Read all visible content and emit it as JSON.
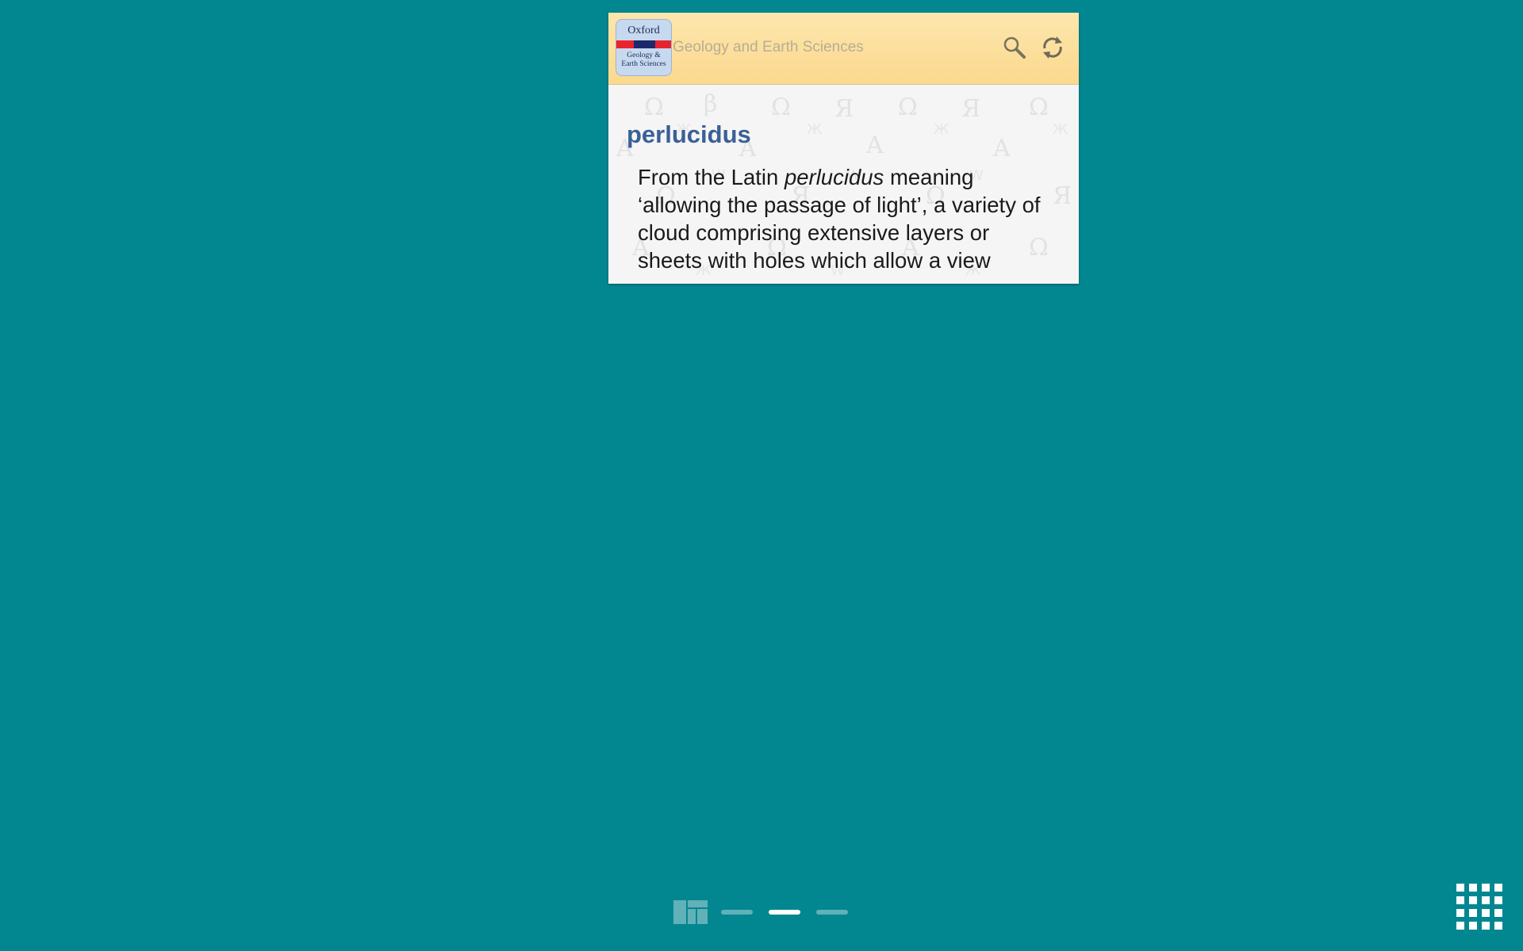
{
  "widget": {
    "logo": {
      "top_text": "Oxford",
      "bottom_line1": "Geology &",
      "bottom_line2": "Earth Sciences"
    },
    "title": "Geology and Earth Sciences",
    "icons": {
      "search": "search-icon",
      "refresh": "refresh-icon"
    },
    "entry": {
      "headword": "perlucidus",
      "text_before": "From the Latin ",
      "text_italic": "perlucidus",
      "text_after": " meaning ‘allowing the passage of light’, a variety of cloud comprising extensive layers or sheets with holes which allow a view"
    }
  },
  "homescreen": {
    "dock_icons": [
      "widgets-icon",
      "apps-grid-icon"
    ],
    "pages": [
      {
        "active": false
      },
      {
        "active": true
      },
      {
        "active": false
      }
    ]
  },
  "colors": {
    "background": "#028791",
    "header": "#fbd98e",
    "headword": "#3a6096"
  }
}
